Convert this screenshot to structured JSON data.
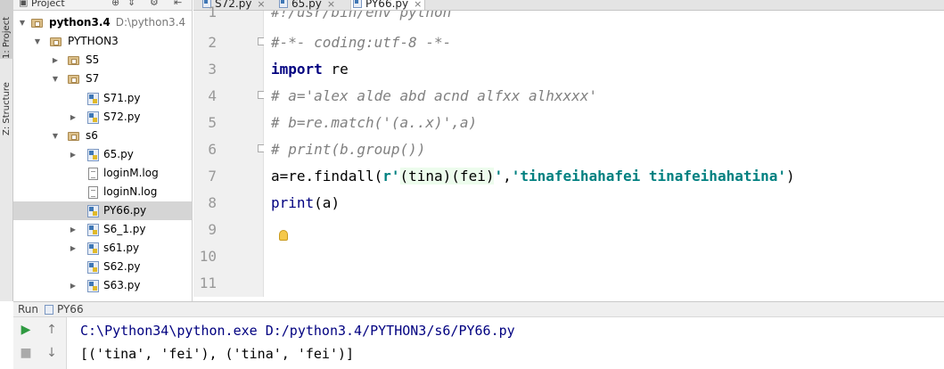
{
  "toolstrip": {
    "project_tab": "1: Project",
    "structure_tab": "Z: Structure"
  },
  "project_panel": {
    "header_label": "Project",
    "header_icons": [
      "target-icon",
      "collapse-icon",
      "gear-icon",
      "hide-icon"
    ],
    "tree": [
      {
        "label": "python3.4",
        "path": "D:\\python3.4",
        "type": "root-folder",
        "expanded": true
      },
      {
        "label": "PYTHON3",
        "type": "folder",
        "expanded": true
      },
      {
        "label": "S5",
        "type": "folder",
        "expanded": false
      },
      {
        "label": "S7",
        "type": "folder",
        "expanded": true
      },
      {
        "label": "S71.py",
        "type": "py"
      },
      {
        "label": "S72.py",
        "type": "py",
        "expandable": true
      },
      {
        "label": "s6",
        "type": "folder",
        "expanded": true
      },
      {
        "label": "65.py",
        "type": "py",
        "expandable": true
      },
      {
        "label": "loginM.log",
        "type": "log"
      },
      {
        "label": "loginN.log",
        "type": "log"
      },
      {
        "label": "PY66.py",
        "type": "py",
        "selected": true
      },
      {
        "label": "S6_1.py",
        "type": "py",
        "expandable": true
      },
      {
        "label": "s61.py",
        "type": "py",
        "expandable": true
      },
      {
        "label": "S62.py",
        "type": "py"
      },
      {
        "label": "S63.py",
        "type": "py",
        "expandable": true
      }
    ]
  },
  "editor_tabs": [
    {
      "label": "S72.py",
      "active": false
    },
    {
      "label": "65.py",
      "active": false
    },
    {
      "label": "PY66.py",
      "active": true
    }
  ],
  "editor": {
    "line_numbers": [
      "1",
      "2",
      "3",
      "4",
      "5",
      "6",
      "7",
      "8",
      "9",
      "10",
      "11"
    ],
    "line1": "#!/usr/bin/env python",
    "line2": "#-*- coding:utf-8 -*-",
    "line3_kw": "import",
    "line3_rest": " re",
    "line4": "# a='alex alde abd acnd alfxx alhxxxx'",
    "line5": "# b=re.match('(a..x)',a)",
    "line6": "# print(b.group())",
    "line7_a": "a=re.findall(",
    "line7_r": "r'",
    "line7_regex": "(tina)(fei)",
    "line7_q": "'",
    "line7_comma": ",",
    "line7_str": "'tinafeihahafei tinafeihahatina'",
    "line7_close": ")",
    "line8_kw": "print",
    "line8_rest": "(a)",
    "intention_bulb": "lightbulb-icon"
  },
  "run_panel": {
    "title": "Run",
    "config_name": "PY66",
    "toolbar_icons": [
      "run-icon",
      "up-arrow-icon",
      "stop-icon",
      "down-arrow-icon"
    ],
    "command": "C:\\Python34\\python.exe D:/python3.4/PYTHON3/s6/PY66.py",
    "output": "[('tina', 'fei'), ('tina', 'fei')]"
  }
}
